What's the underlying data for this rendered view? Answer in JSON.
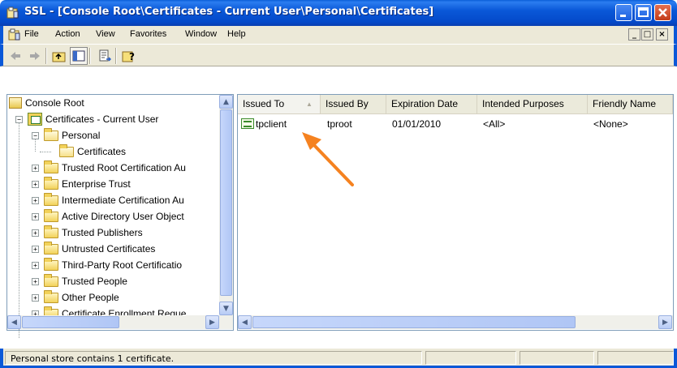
{
  "window": {
    "title": "SSL - [Console Root\\Certificates - Current User\\Personal\\Certificates]"
  },
  "menu": {
    "items": [
      "File",
      "Action",
      "View",
      "Favorites",
      "Window",
      "Help"
    ]
  },
  "toolbar": {
    "buttons": [
      "back-icon",
      "forward-icon",
      "up-folder-icon",
      "show-hide-tree-icon",
      "export-list-icon",
      "help-icon"
    ]
  },
  "tree": {
    "items": [
      {
        "label": "Console Root"
      },
      {
        "label": "Certificates - Current User"
      },
      {
        "label": "Personal"
      },
      {
        "label": "Certificates"
      },
      {
        "label": "Trusted Root Certification Au"
      },
      {
        "label": "Enterprise Trust"
      },
      {
        "label": "Intermediate Certification Au"
      },
      {
        "label": "Active Directory User Object"
      },
      {
        "label": "Trusted Publishers"
      },
      {
        "label": "Untrusted Certificates"
      },
      {
        "label": "Third-Party Root Certificatio"
      },
      {
        "label": "Trusted People"
      },
      {
        "label": "Other People"
      },
      {
        "label": "Certificate Enrollment Reque"
      }
    ]
  },
  "list": {
    "columns": [
      "Issued To",
      "Issued By",
      "Expiration Date",
      "Intended Purposes",
      "Friendly Name"
    ],
    "rows": [
      {
        "issued_to": "tpclient",
        "issued_by": "tproot",
        "expiration": "01/01/2010",
        "purposes": "<All>",
        "friendly_name": "<None>"
      }
    ]
  },
  "status": {
    "text": "Personal store contains 1 certificate."
  },
  "colors": {
    "titlebar": "#0a58d8",
    "annotation_arrow": "#f58220"
  }
}
